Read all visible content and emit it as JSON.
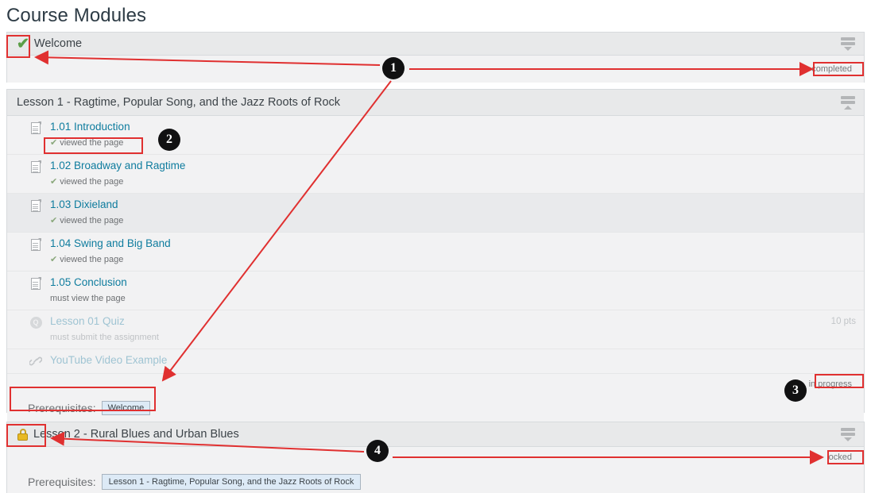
{
  "page": {
    "title": "Course Modules"
  },
  "modules": [
    {
      "id": "welcome",
      "title": "Welcome",
      "state_icon": "green-check-icon",
      "handle_icon": "drag-handle-down-icon",
      "status_badge": "completed",
      "items": [],
      "prerequisites": null
    },
    {
      "id": "lesson-1",
      "title": "Lesson 1 - Ragtime, Popular Song, and the Jazz Roots of Rock",
      "state_icon": null,
      "handle_icon": "drag-handle-up-icon",
      "status_badge": "in progress",
      "items": [
        {
          "icon": "document-icon",
          "title": "1.01 Introduction",
          "requirement": "viewed the page",
          "requirement_met": true,
          "points": null,
          "muted": false
        },
        {
          "icon": "document-icon",
          "title": "1.02 Broadway and Ragtime",
          "requirement": "viewed the page",
          "requirement_met": true,
          "points": null,
          "muted": false
        },
        {
          "icon": "document-icon",
          "title": "1.03 Dixieland",
          "requirement": "viewed the page",
          "requirement_met": true,
          "points": null,
          "muted": false
        },
        {
          "icon": "document-icon",
          "title": "1.04 Swing and Big Band",
          "requirement": "viewed the page",
          "requirement_met": true,
          "points": null,
          "muted": false
        },
        {
          "icon": "document-icon",
          "title": "1.05 Conclusion",
          "requirement": "must view the page",
          "requirement_met": false,
          "points": null,
          "muted": false
        },
        {
          "icon": "quiz-icon",
          "title": "Lesson 01 Quiz",
          "requirement": "must submit the assignment",
          "requirement_met": false,
          "points": "10 pts",
          "muted": true
        },
        {
          "icon": "link-icon",
          "title": "YouTube Video Example",
          "requirement": null,
          "requirement_met": false,
          "points": null,
          "muted": true
        }
      ],
      "prerequisites": {
        "label": "Prerequisites:",
        "values": [
          "Welcome"
        ]
      }
    },
    {
      "id": "lesson-2",
      "title": "Lesson 2 - Rural Blues and Urban Blues",
      "state_icon": "lock-icon",
      "handle_icon": "drag-handle-down-icon",
      "status_badge": "locked",
      "items": [],
      "prerequisites": {
        "label": "Prerequisites:",
        "values": [
          "Lesson 1 - Ragtime, Popular Song, and the Jazz Roots of Rock"
        ]
      }
    }
  ],
  "annotations": {
    "accent_color": "#e03030",
    "markers": [
      {
        "number": "1"
      },
      {
        "number": "2"
      },
      {
        "number": "3"
      },
      {
        "number": "4"
      }
    ]
  },
  "icons": {
    "quiz_glyph": "Q"
  }
}
